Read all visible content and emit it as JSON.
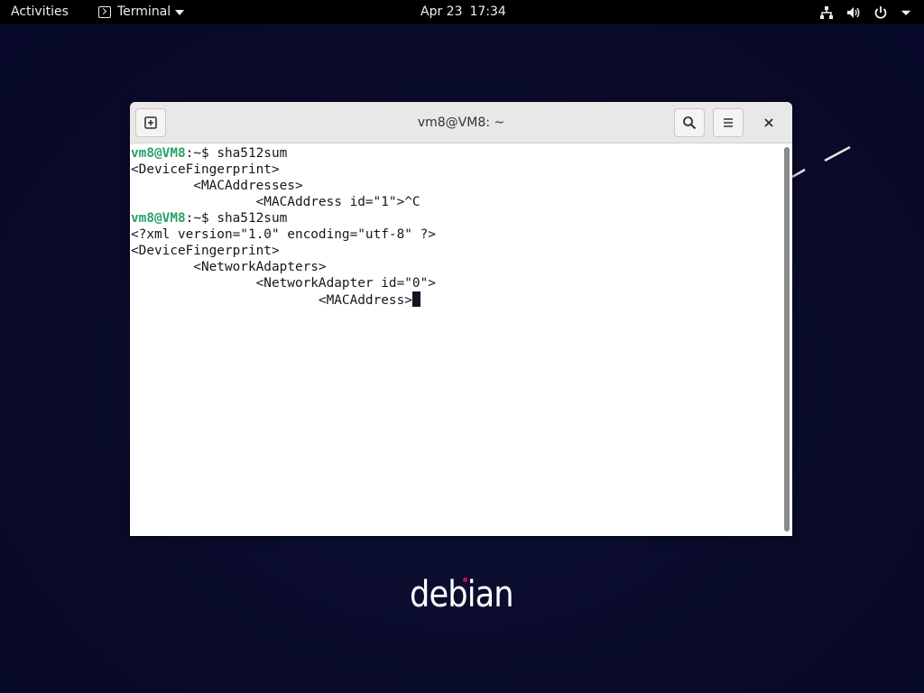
{
  "topbar": {
    "activities_label": "Activities",
    "app_name": "Terminal",
    "date": "Apr 23",
    "time": "17:34",
    "tray_icons": [
      "network-icon",
      "volume-icon",
      "power-icon",
      "chevron-down-icon"
    ]
  },
  "terminal": {
    "title": "vm8@VM8: ~",
    "header_icons": [
      "new-tab-icon",
      "search-icon",
      "hamburger-menu-icon",
      "close-icon"
    ],
    "colors": {
      "prompt_user": "#26a269",
      "text": "#171421",
      "background": "#ffffff"
    },
    "lines": [
      {
        "prompt_user": "vm8@VM8",
        "prompt_rest": ":~$ ",
        "text": "sha512sum"
      },
      {
        "prompt_user": "",
        "prompt_rest": "",
        "text": "<DeviceFingerprint>"
      },
      {
        "prompt_user": "",
        "prompt_rest": "",
        "text": "        <MACAddresses>"
      },
      {
        "prompt_user": "",
        "prompt_rest": "",
        "text": "                <MACAddress id=\"1\">^C"
      },
      {
        "prompt_user": "vm8@VM8",
        "prompt_rest": ":~$ ",
        "text": "sha512sum"
      },
      {
        "prompt_user": "",
        "prompt_rest": "",
        "text": "<?xml version=\"1.0\" encoding=\"utf-8\" ?>"
      },
      {
        "prompt_user": "",
        "prompt_rest": "",
        "text": "<DeviceFingerprint>"
      },
      {
        "prompt_user": "",
        "prompt_rest": "",
        "text": "        <NetworkAdapters>"
      },
      {
        "prompt_user": "",
        "prompt_rest": "",
        "text": "                <NetworkAdapter id=\"0\">"
      },
      {
        "prompt_user": "",
        "prompt_rest": "",
        "text": "                        <MACAddress>"
      }
    ]
  },
  "desktop": {
    "logo_text": "debian"
  }
}
